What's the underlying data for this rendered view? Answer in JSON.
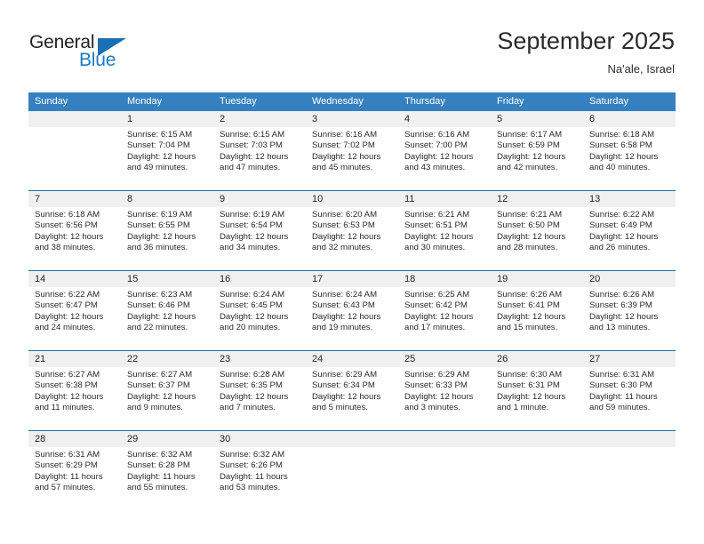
{
  "brand": {
    "name_dark": "General",
    "name_blue": "Blue",
    "accent_color": "#1b6fb5"
  },
  "header": {
    "title": "September 2025",
    "subtitle": "Na'ale, Israel"
  },
  "calendar": {
    "header_bg": "#3580c0",
    "row_divider_color": "#2a6ead",
    "daynum_bg": "#f0f0f0",
    "weekdays": [
      "Sunday",
      "Monday",
      "Tuesday",
      "Wednesday",
      "Thursday",
      "Friday",
      "Saturday"
    ],
    "weeks": [
      [
        {
          "day": "",
          "sunrise": "",
          "sunset": "",
          "daylight": ""
        },
        {
          "day": "1",
          "sunrise": "Sunrise: 6:15 AM",
          "sunset": "Sunset: 7:04 PM",
          "daylight": "Daylight: 12 hours and 49 minutes."
        },
        {
          "day": "2",
          "sunrise": "Sunrise: 6:15 AM",
          "sunset": "Sunset: 7:03 PM",
          "daylight": "Daylight: 12 hours and 47 minutes."
        },
        {
          "day": "3",
          "sunrise": "Sunrise: 6:16 AM",
          "sunset": "Sunset: 7:02 PM",
          "daylight": "Daylight: 12 hours and 45 minutes."
        },
        {
          "day": "4",
          "sunrise": "Sunrise: 6:16 AM",
          "sunset": "Sunset: 7:00 PM",
          "daylight": "Daylight: 12 hours and 43 minutes."
        },
        {
          "day": "5",
          "sunrise": "Sunrise: 6:17 AM",
          "sunset": "Sunset: 6:59 PM",
          "daylight": "Daylight: 12 hours and 42 minutes."
        },
        {
          "day": "6",
          "sunrise": "Sunrise: 6:18 AM",
          "sunset": "Sunset: 6:58 PM",
          "daylight": "Daylight: 12 hours and 40 minutes."
        }
      ],
      [
        {
          "day": "7",
          "sunrise": "Sunrise: 6:18 AM",
          "sunset": "Sunset: 6:56 PM",
          "daylight": "Daylight: 12 hours and 38 minutes."
        },
        {
          "day": "8",
          "sunrise": "Sunrise: 6:19 AM",
          "sunset": "Sunset: 6:55 PM",
          "daylight": "Daylight: 12 hours and 36 minutes."
        },
        {
          "day": "9",
          "sunrise": "Sunrise: 6:19 AM",
          "sunset": "Sunset: 6:54 PM",
          "daylight": "Daylight: 12 hours and 34 minutes."
        },
        {
          "day": "10",
          "sunrise": "Sunrise: 6:20 AM",
          "sunset": "Sunset: 6:53 PM",
          "daylight": "Daylight: 12 hours and 32 minutes."
        },
        {
          "day": "11",
          "sunrise": "Sunrise: 6:21 AM",
          "sunset": "Sunset: 6:51 PM",
          "daylight": "Daylight: 12 hours and 30 minutes."
        },
        {
          "day": "12",
          "sunrise": "Sunrise: 6:21 AM",
          "sunset": "Sunset: 6:50 PM",
          "daylight": "Daylight: 12 hours and 28 minutes."
        },
        {
          "day": "13",
          "sunrise": "Sunrise: 6:22 AM",
          "sunset": "Sunset: 6:49 PM",
          "daylight": "Daylight: 12 hours and 26 minutes."
        }
      ],
      [
        {
          "day": "14",
          "sunrise": "Sunrise: 6:22 AM",
          "sunset": "Sunset: 6:47 PM",
          "daylight": "Daylight: 12 hours and 24 minutes."
        },
        {
          "day": "15",
          "sunrise": "Sunrise: 6:23 AM",
          "sunset": "Sunset: 6:46 PM",
          "daylight": "Daylight: 12 hours and 22 minutes."
        },
        {
          "day": "16",
          "sunrise": "Sunrise: 6:24 AM",
          "sunset": "Sunset: 6:45 PM",
          "daylight": "Daylight: 12 hours and 20 minutes."
        },
        {
          "day": "17",
          "sunrise": "Sunrise: 6:24 AM",
          "sunset": "Sunset: 6:43 PM",
          "daylight": "Daylight: 12 hours and 19 minutes."
        },
        {
          "day": "18",
          "sunrise": "Sunrise: 6:25 AM",
          "sunset": "Sunset: 6:42 PM",
          "daylight": "Daylight: 12 hours and 17 minutes."
        },
        {
          "day": "19",
          "sunrise": "Sunrise: 6:26 AM",
          "sunset": "Sunset: 6:41 PM",
          "daylight": "Daylight: 12 hours and 15 minutes."
        },
        {
          "day": "20",
          "sunrise": "Sunrise: 6:26 AM",
          "sunset": "Sunset: 6:39 PM",
          "daylight": "Daylight: 12 hours and 13 minutes."
        }
      ],
      [
        {
          "day": "21",
          "sunrise": "Sunrise: 6:27 AM",
          "sunset": "Sunset: 6:38 PM",
          "daylight": "Daylight: 12 hours and 11 minutes."
        },
        {
          "day": "22",
          "sunrise": "Sunrise: 6:27 AM",
          "sunset": "Sunset: 6:37 PM",
          "daylight": "Daylight: 12 hours and 9 minutes."
        },
        {
          "day": "23",
          "sunrise": "Sunrise: 6:28 AM",
          "sunset": "Sunset: 6:35 PM",
          "daylight": "Daylight: 12 hours and 7 minutes."
        },
        {
          "day": "24",
          "sunrise": "Sunrise: 6:29 AM",
          "sunset": "Sunset: 6:34 PM",
          "daylight": "Daylight: 12 hours and 5 minutes."
        },
        {
          "day": "25",
          "sunrise": "Sunrise: 6:29 AM",
          "sunset": "Sunset: 6:33 PM",
          "daylight": "Daylight: 12 hours and 3 minutes."
        },
        {
          "day": "26",
          "sunrise": "Sunrise: 6:30 AM",
          "sunset": "Sunset: 6:31 PM",
          "daylight": "Daylight: 12 hours and 1 minute."
        },
        {
          "day": "27",
          "sunrise": "Sunrise: 6:31 AM",
          "sunset": "Sunset: 6:30 PM",
          "daylight": "Daylight: 11 hours and 59 minutes."
        }
      ],
      [
        {
          "day": "28",
          "sunrise": "Sunrise: 6:31 AM",
          "sunset": "Sunset: 6:29 PM",
          "daylight": "Daylight: 11 hours and 57 minutes."
        },
        {
          "day": "29",
          "sunrise": "Sunrise: 6:32 AM",
          "sunset": "Sunset: 6:28 PM",
          "daylight": "Daylight: 11 hours and 55 minutes."
        },
        {
          "day": "30",
          "sunrise": "Sunrise: 6:32 AM",
          "sunset": "Sunset: 6:26 PM",
          "daylight": "Daylight: 11 hours and 53 minutes."
        },
        {
          "day": "",
          "sunrise": "",
          "sunset": "",
          "daylight": ""
        },
        {
          "day": "",
          "sunrise": "",
          "sunset": "",
          "daylight": ""
        },
        {
          "day": "",
          "sunrise": "",
          "sunset": "",
          "daylight": ""
        },
        {
          "day": "",
          "sunrise": "",
          "sunset": "",
          "daylight": ""
        }
      ]
    ]
  }
}
